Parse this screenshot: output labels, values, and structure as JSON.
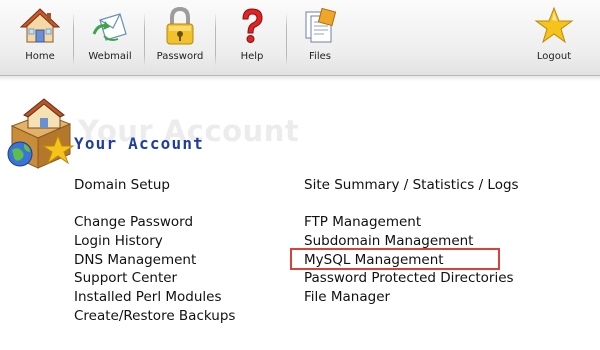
{
  "toolbar": {
    "items": [
      {
        "label": "Home",
        "icon": "home-icon"
      },
      {
        "label": "Webmail",
        "icon": "webmail-icon"
      },
      {
        "label": "Password",
        "icon": "lock-icon"
      },
      {
        "label": "Help",
        "icon": "help-icon"
      },
      {
        "label": "Files",
        "icon": "files-icon"
      }
    ],
    "logout": {
      "label": "Logout",
      "icon": "star-icon"
    }
  },
  "account": {
    "watermark": "Your Account",
    "title": "Your Account"
  },
  "left_column": {
    "heading": "Domain Setup",
    "links": [
      "Change Password",
      "Login History",
      "DNS Management",
      "Support Center",
      "Installed Perl Modules",
      "Create/Restore Backups"
    ]
  },
  "right_column": {
    "heading": "Site Summary / Statistics / Logs",
    "links": [
      "FTP Management",
      "Subdomain Management",
      "MySQL Management",
      "Password Protected Directories",
      "File Manager"
    ]
  },
  "colors": {
    "title": "#1e3fa0",
    "highlight": "#d9413b"
  }
}
